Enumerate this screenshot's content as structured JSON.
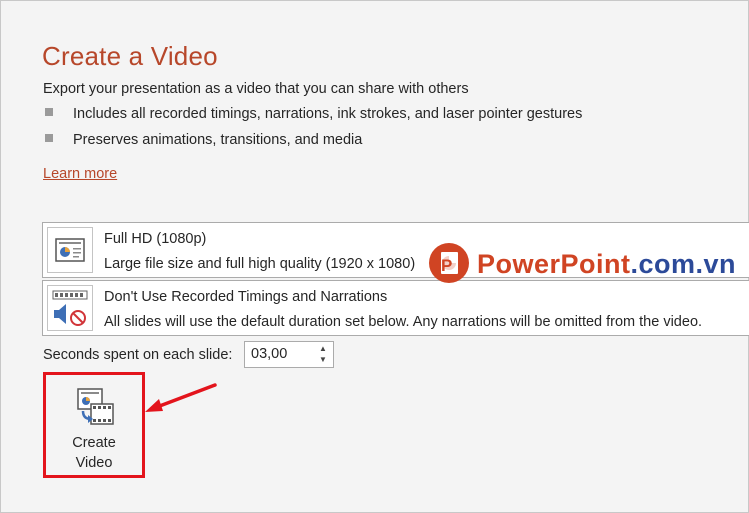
{
  "header": {
    "title": "Create a Video",
    "subtitle": "Export your presentation as a video that you can share with others",
    "bullets": [
      "Includes all recorded timings, narrations, ink strokes, and laser pointer gestures",
      "Preserves animations, transitions, and media"
    ],
    "learn_more": "Learn more"
  },
  "quality_dropdown": {
    "title": "Full HD (1080p)",
    "description": "Large file size and full high quality (1920 x 1080)",
    "icon": "presentation-quality-icon"
  },
  "timings_dropdown": {
    "title": "Don't Use Recorded Timings and Narrations",
    "description": "All slides will use the default duration set below. Any narrations will be omitted from the video.",
    "icon": "no-narration-icon"
  },
  "seconds": {
    "label": "Seconds spent on each slide:",
    "value": "03,00"
  },
  "create_button": {
    "label": "Create\nVideo",
    "icon": "create-video-icon",
    "highlight_color": "#e3141c"
  },
  "watermark": {
    "text_main": "PowerPoint",
    "text_domain": ".com.vn",
    "logo_letter": "P"
  },
  "colors": {
    "accent": "#b7472a",
    "background": "#f4f4f4",
    "highlight": "#e3141c"
  }
}
